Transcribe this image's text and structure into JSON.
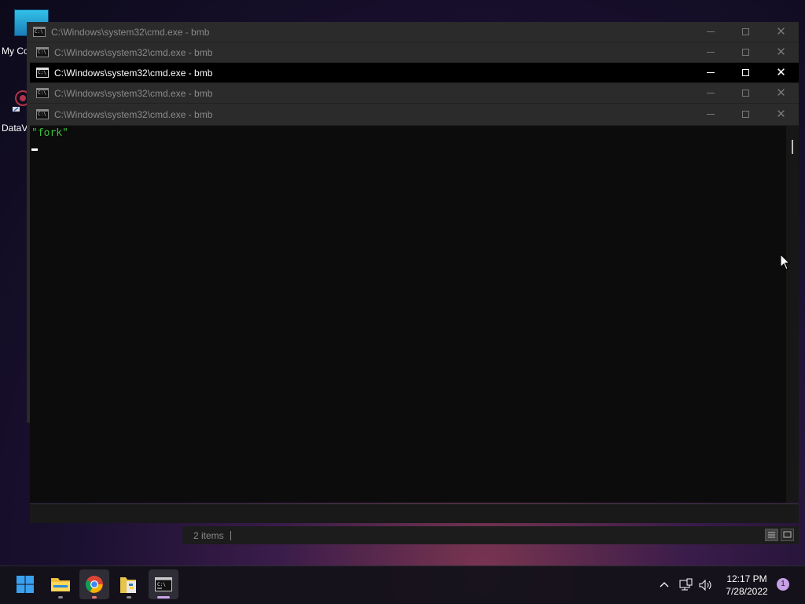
{
  "desktop": {
    "icons": [
      {
        "label": "My Co"
      },
      {
        "label": "DataV"
      }
    ]
  },
  "windows": [
    {
      "title": "C:\\Windows\\system32\\cmd.exe - bmb",
      "active": false
    },
    {
      "title": "C:\\Windows\\system32\\cmd.exe - bmb",
      "active": false
    },
    {
      "title": "C:\\Windows\\system32\\cmd.exe - bmb",
      "active": true
    },
    {
      "title": "C:\\Windows\\system32\\cmd.exe - bmb",
      "active": false
    },
    {
      "title": "C:\\Windows\\system32\\cmd.exe - bmb",
      "active": false
    }
  ],
  "console": {
    "output_line": "\"fork\""
  },
  "explorer": {
    "status_text": "2 items"
  },
  "taskbar": {
    "apps": [
      "start-icon",
      "file-explorer-icon",
      "chrome-icon",
      "python-file-icon",
      "cmd-icon"
    ],
    "clock_time": "12:17 PM",
    "clock_date": "7/28/2022",
    "notification_count": "1"
  },
  "colors": {
    "console_text": "#3cc13c",
    "active_titlebar": "#000000",
    "inactive_titlebar": "#2b2b2b"
  }
}
